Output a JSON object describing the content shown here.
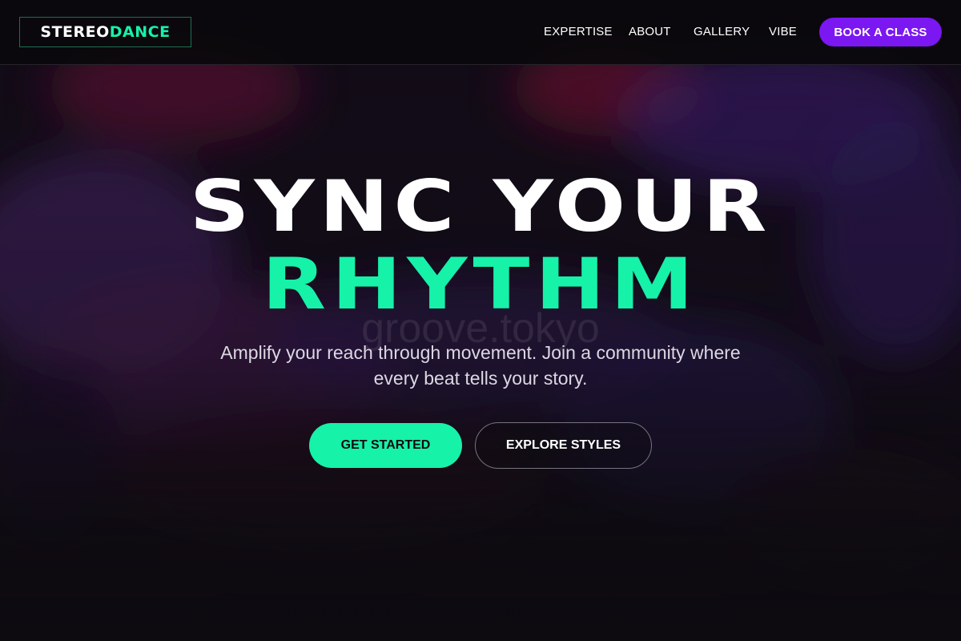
{
  "brand": {
    "part1": "STEREO",
    "part2": "DANCE"
  },
  "nav": {
    "items": [
      "EXPERTISE",
      "ABOUT",
      "GALLERY",
      "VIBE"
    ],
    "cta": "BOOK A CLASS"
  },
  "hero": {
    "line1": "SYNC YOUR",
    "line2": "RHYTHM",
    "watermark": "groove.tokyo",
    "subtitle": "Amplify your reach through movement. Join a community where every beat tells your story.",
    "primary_button": "GET STARTED",
    "secondary_button": "EXPLORE STYLES"
  },
  "colors": {
    "accent": "#16f2a8",
    "purple": "#7b17f0",
    "background": "#0d0b10"
  }
}
